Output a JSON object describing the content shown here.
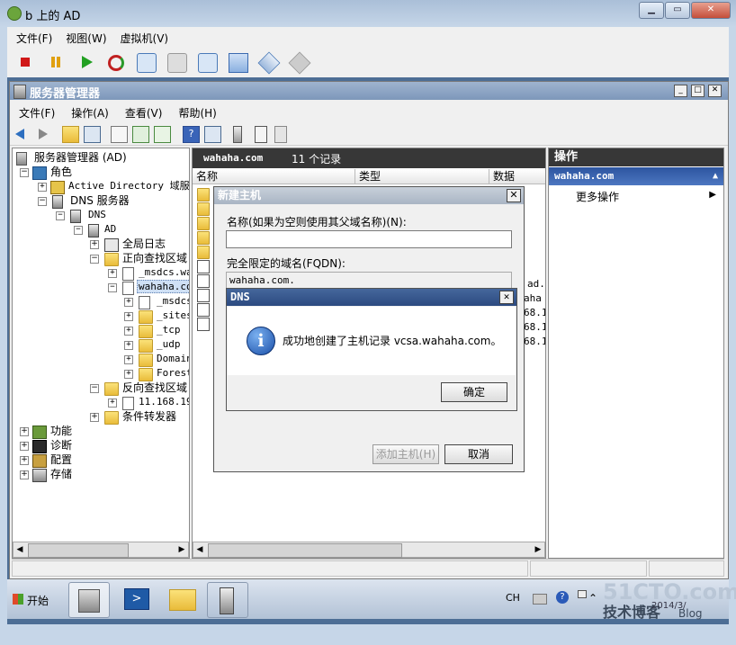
{
  "outer": {
    "title": "b 上的 AD",
    "menu": [
      "文件(F)",
      "视图(W)",
      "虚拟机(V)"
    ]
  },
  "server_manager": {
    "title": "服务器管理器",
    "menu": [
      "文件(F)",
      "操作(A)",
      "查看(V)",
      "帮助(H)"
    ],
    "tree": [
      {
        "label": "服务器管理器 (AD)",
        "expander": ""
      },
      {
        "label": "角色",
        "expander": "−"
      },
      {
        "label": "Active Directory 域服务",
        "expander": "+"
      },
      {
        "label": "DNS 服务器",
        "expander": "−"
      },
      {
        "label": "DNS",
        "expander": "−"
      },
      {
        "label": "AD",
        "expander": "−"
      },
      {
        "label": "全局日志",
        "expander": "+"
      },
      {
        "label": "正向查找区域",
        "expander": "−"
      },
      {
        "label": "_msdcs.wa",
        "expander": "+"
      },
      {
        "label": "wahaha.co",
        "expander": "−"
      },
      {
        "label": "_msdcs",
        "expander": "+"
      },
      {
        "label": "_sites",
        "expander": "+"
      },
      {
        "label": "_tcp",
        "expander": "+"
      },
      {
        "label": "_udp",
        "expander": "+"
      },
      {
        "label": "Domain",
        "expander": "+"
      },
      {
        "label": "Forest",
        "expander": "+"
      },
      {
        "label": "反向查找区域",
        "expander": "−"
      },
      {
        "label": "11.168.19",
        "expander": "+"
      },
      {
        "label": "条件转发器",
        "expander": "+"
      },
      {
        "label": "功能",
        "expander": "+"
      },
      {
        "label": "诊断",
        "expander": "+"
      },
      {
        "label": "配置",
        "expander": "+"
      },
      {
        "label": "存储",
        "expander": "+"
      }
    ],
    "center": {
      "zone": "wahaha.com",
      "count": "11 个记录",
      "columns": [
        "名称",
        "类型",
        "数据"
      ],
      "data_fragments": [
        "ad.",
        "aha",
        "68.1",
        "68.1",
        "68.1"
      ]
    },
    "actions": {
      "header": "操作",
      "zone": "wahaha.com",
      "more": "更多操作"
    }
  },
  "new_host_dialog": {
    "title": "新建主机",
    "close": "✕",
    "name_label": "名称(如果为空则使用其父域名称)(N):",
    "name_value": "",
    "fqdn_label": "完全限定的域名(FQDN):",
    "fqdn_value": "wahaha.com.",
    "add_button": "添加主机(H)",
    "cancel_button": "取消"
  },
  "dns_dialog": {
    "title": "DNS",
    "close": "✕",
    "message": "成功地创建了主机记录 vcsa.wahaha.com。",
    "ok_button": "确定"
  },
  "taskbar": {
    "start": "开始",
    "tray_ch": "CH",
    "watermark_main": "51CTO.com",
    "watermark_sub": "技术博客",
    "watermark_blog": "Blog",
    "clock": "2014/3/"
  }
}
